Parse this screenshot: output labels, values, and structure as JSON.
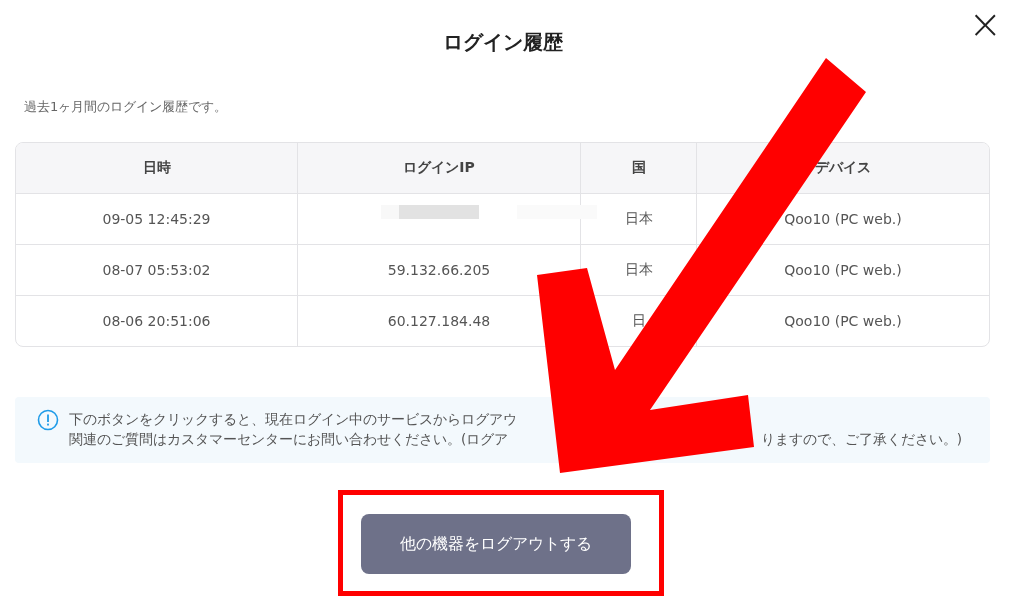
{
  "dialog": {
    "title": "ログイン履歴",
    "close": "×"
  },
  "subtitle": "過去1ヶ月間のログイン履歴です。",
  "table": {
    "columns": [
      "日時",
      "ログインIP",
      "国",
      "デバイス"
    ],
    "rows": [
      {
        "time": "09-05 12:45:29",
        "country": "日本",
        "device": "Qoo10 (PC web.)"
      },
      {
        "time": "08-07 05:53:02",
        "ip": "59.132.66.205",
        "country": "日本",
        "device": "Qoo10 (PC web.)"
      },
      {
        "time": "08-06 20:51:06",
        "ip": "60.127.184.48",
        "country": "日",
        "device": "Qoo10 (PC web.)"
      }
    ]
  },
  "notice": {
    "lines": [
      [
        "下のボタンをクリックすると、現在ログイン中のサービスからログアウ"
      ],
      [
        "関連のご質問はカスタマーセンターにお問い合わせください。(ログア",
        "りますので、ご了承ください。)"
      ]
    ]
  },
  "button": "他の機器をログアウトする"
}
